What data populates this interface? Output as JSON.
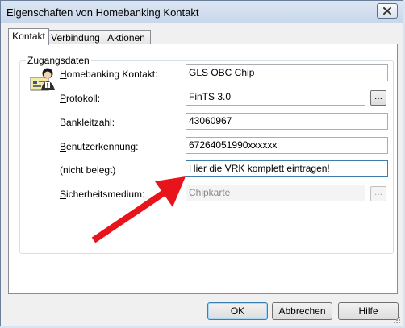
{
  "window": {
    "title": "Eigenschaften von Homebanking Kontakt"
  },
  "tabs": [
    {
      "label": "Kontakt"
    },
    {
      "label": "Verbindung"
    },
    {
      "label": "Aktionen"
    }
  ],
  "group": {
    "label": "Zugangsdaten"
  },
  "fields": {
    "kontakt": {
      "label_ul": "H",
      "label_rest": "omebanking Kontakt:",
      "value": "GLS OBC Chip"
    },
    "protokoll": {
      "label_ul": "P",
      "label_rest": "rotokoll:",
      "value": "FinTS 3.0"
    },
    "blz": {
      "label_ul": "B",
      "label_rest": "ankleitzahl:",
      "value": "43060967"
    },
    "benutzer": {
      "label_ul": "B",
      "label_rest": "enutzerkennung:",
      "value": "67264051990xxxxxx"
    },
    "unbelegt": {
      "label": "(nicht belegt)",
      "value": "Hier die VRK komplett eintragen!"
    },
    "sicherheit": {
      "label_ul": "S",
      "label_rest": "icherheitsmedium:",
      "value": "Chipkarte"
    }
  },
  "browse_label": "...",
  "buttons": {
    "ok": "OK",
    "cancel": "Abbrechen",
    "help": "Hilfe"
  },
  "colors": {
    "arrow": "#e8141c",
    "focus_border": "#3d7bad"
  }
}
